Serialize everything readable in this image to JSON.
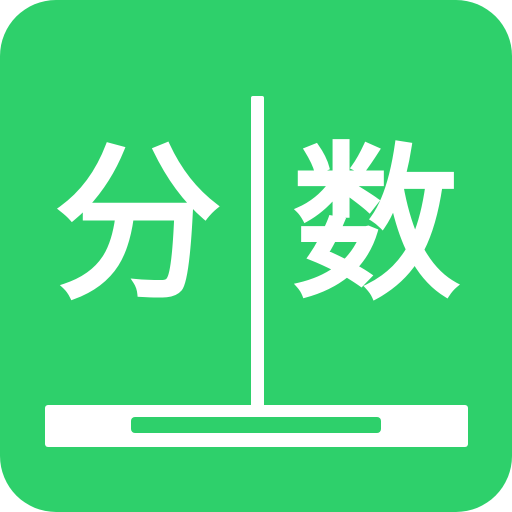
{
  "app_icon": {
    "left_character": "分",
    "right_character": "数"
  },
  "colors": {
    "background": "#2ed06b",
    "foreground": "#ffffff",
    "slot": "#2ed06b"
  }
}
